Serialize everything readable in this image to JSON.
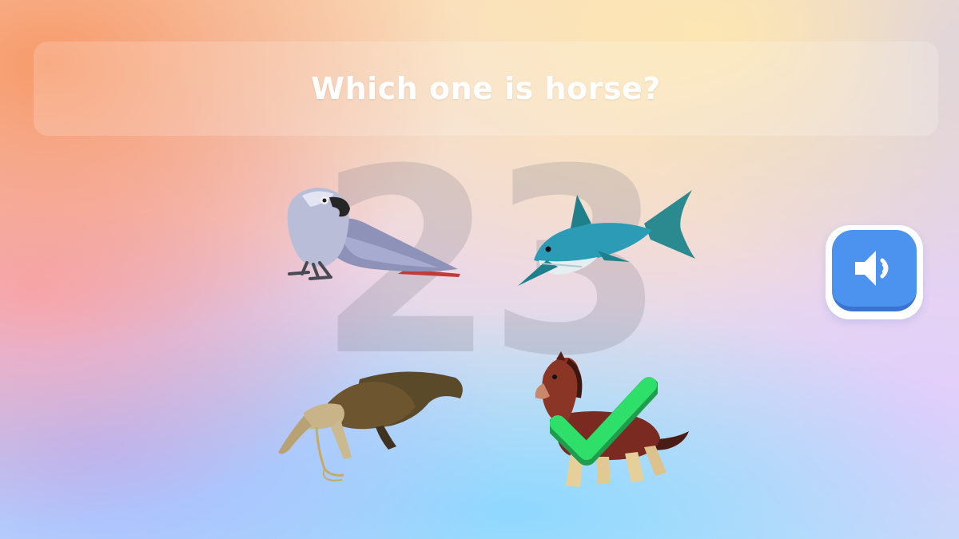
{
  "quiz": {
    "question": "Which one is horse?",
    "countdown": "23",
    "correct_answer": "horse"
  },
  "options": [
    {
      "animal": "parrot",
      "icon": "parrot-icon"
    },
    {
      "animal": "shark",
      "icon": "shark-icon"
    },
    {
      "animal": "anteater",
      "icon": "anteater-icon"
    },
    {
      "animal": "horse",
      "icon": "horse-icon",
      "selected": true,
      "correct": true
    }
  ],
  "controls": {
    "sound_icon": "speaker-icon"
  },
  "colors": {
    "check": "#2ee06a",
    "sound_button": "#4c93f0",
    "question_text": "#ffffff"
  }
}
